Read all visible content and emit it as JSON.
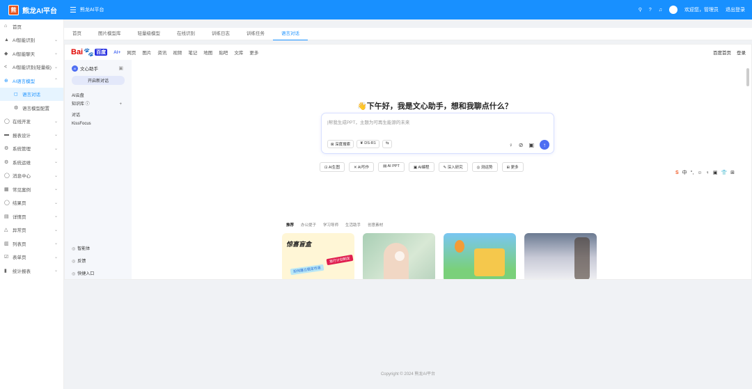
{
  "topbar": {
    "brand": "熊龙AI平台",
    "logo_char": "熊",
    "breadcrumb": "熊龙AI平台",
    "icons": [
      "search-icon",
      "help-icon",
      "bell-icon"
    ],
    "user": "欢迎您，管理员",
    "logout": "退出登录"
  },
  "sidebar": {
    "items": [
      {
        "icon": "⌂",
        "label": "首页"
      },
      {
        "icon": "▲",
        "label": "AI智能识别",
        "arrow": "⌄"
      },
      {
        "icon": "◆",
        "label": "AI智能聊天",
        "arrow": "⌄"
      },
      {
        "icon": "<",
        "label": "AI智能识别(轻量级)",
        "arrow": "⌄"
      },
      {
        "icon": "⊕",
        "label": "AI语言模型",
        "arrow": "⌃"
      }
    ],
    "sub": [
      {
        "icon": "◻",
        "label": "语言对话"
      },
      {
        "icon": "⚙",
        "label": "语言模型配置"
      }
    ],
    "items2": [
      {
        "icon": "◯",
        "label": "在线开发",
        "arrow": "⌄"
      },
      {
        "icon": "▬",
        "label": "报表设计",
        "arrow": "⌄"
      },
      {
        "icon": "⚙",
        "label": "系统管理",
        "arrow": "⌄"
      },
      {
        "icon": "⚙",
        "label": "系统运维",
        "arrow": "⌄"
      },
      {
        "icon": "◯",
        "label": "消息中心",
        "arrow": "⌄"
      },
      {
        "icon": "▦",
        "label": "常见案例",
        "arrow": "⌄"
      },
      {
        "icon": "◯",
        "label": "结果页",
        "arrow": "⌄"
      },
      {
        "icon": "▤",
        "label": "详情页",
        "arrow": "⌄"
      },
      {
        "icon": "△",
        "label": "异常页",
        "arrow": "⌄"
      },
      {
        "icon": "▥",
        "label": "列表页",
        "arrow": "⌄"
      },
      {
        "icon": "☑",
        "label": "表单页",
        "arrow": "⌄"
      },
      {
        "icon": "▮",
        "label": "统计报表",
        "arrow": "⌄"
      }
    ]
  },
  "tabs": [
    "首页",
    "图片模型库",
    "轻量级模型",
    "在线识别",
    "训练日志",
    "训练任务",
    "语言对话"
  ],
  "baidu": {
    "logo_text": "Bai",
    "logo_paw": "🐾",
    "logo_badge": "百度",
    "nav": [
      "AI+",
      "网页",
      "图片",
      "资讯",
      "视频",
      "笔记",
      "地图",
      "贴吧",
      "文库",
      "更多"
    ],
    "right": [
      "百度首页",
      "登录"
    ]
  },
  "assistant": {
    "title": "文心助手",
    "new_chat": "开启新对话",
    "links": [
      "AI云盘",
      "知识库 ⓘ",
      "对话",
      "KissFocus"
    ],
    "bottom": [
      {
        "icon": "◎",
        "label": "智能体"
      },
      {
        "icon": "◎",
        "label": "反馈"
      },
      {
        "icon": "◎",
        "label": "快捷入口"
      }
    ]
  },
  "main": {
    "greeting": "👋下午好，我是文心助手，想和我聊点什么？",
    "placeholder": "|帮我生成PPT，主题为可再生能源的未来",
    "tools": [
      "⊠ 深度搜索",
      "❦ DS-R1",
      "⇆"
    ],
    "chips": [
      "⊡ AI生图",
      "✕ AI写作",
      "▤ AI PPT",
      "▣ AI编程",
      "✎ 深入研究",
      "◎ 测运势",
      "⊞ 更多"
    ],
    "categories": [
      "推荐",
      "办公提子",
      "学习导师",
      "生活助手",
      "创意素材"
    ],
    "card1_title": "惊喜盲盒",
    "card1_tag1": "旅行计划制定",
    "card1_tag2": "如何建立稳定作息"
  },
  "ime": [
    "S",
    "中",
    "°,",
    "☺",
    "♀",
    "▣",
    "👕",
    "⊞"
  ],
  "footer": "Copyright © 2024 熊龙AI平台"
}
